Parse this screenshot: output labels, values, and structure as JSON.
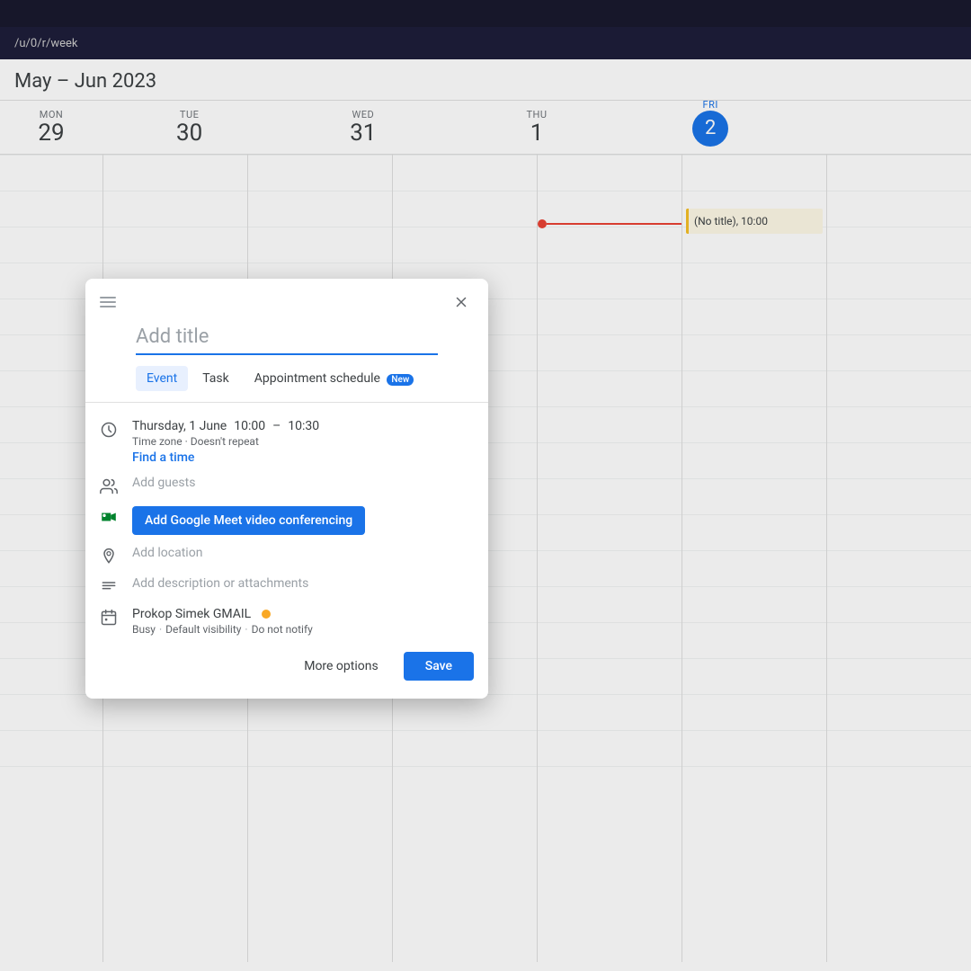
{
  "topbar": {
    "url": "/u/0/r/week"
  },
  "calendar": {
    "month_range": "May – Jun 2023",
    "days": [
      {
        "name": "MON",
        "num": "29",
        "today": false
      },
      {
        "name": "TUE",
        "num": "30",
        "today": false
      },
      {
        "name": "WED",
        "num": "31",
        "today": false
      },
      {
        "name": "THU",
        "num": "1",
        "today": false
      },
      {
        "name": "FRI",
        "num": "2",
        "today": true
      }
    ],
    "event_chip": "(No title), 10:00"
  },
  "dialog": {
    "title_placeholder": "Add title",
    "tabs": [
      {
        "label": "Event",
        "active": true
      },
      {
        "label": "Task",
        "active": false
      },
      {
        "label": "Appointment schedule",
        "active": false,
        "badge": "New"
      }
    ],
    "date_time": {
      "date": "Thursday, 1 June",
      "start": "10:00",
      "separator": "–",
      "end": "10:30"
    },
    "date_sub": "Time zone · Doesn't repeat",
    "find_time": "Find a time",
    "guests_placeholder": "Add guests",
    "meet_button": "Add Google Meet video conferencing",
    "location_placeholder": "Add location",
    "description_placeholder": "Add description or attachments",
    "calendar_owner": "Prokop Simek GMAIL",
    "calendar_sub_busy": "Busy",
    "calendar_sub_visibility": "Default visibility",
    "calendar_sub_notify": "Do not notify",
    "more_options": "More options",
    "save": "Save"
  }
}
